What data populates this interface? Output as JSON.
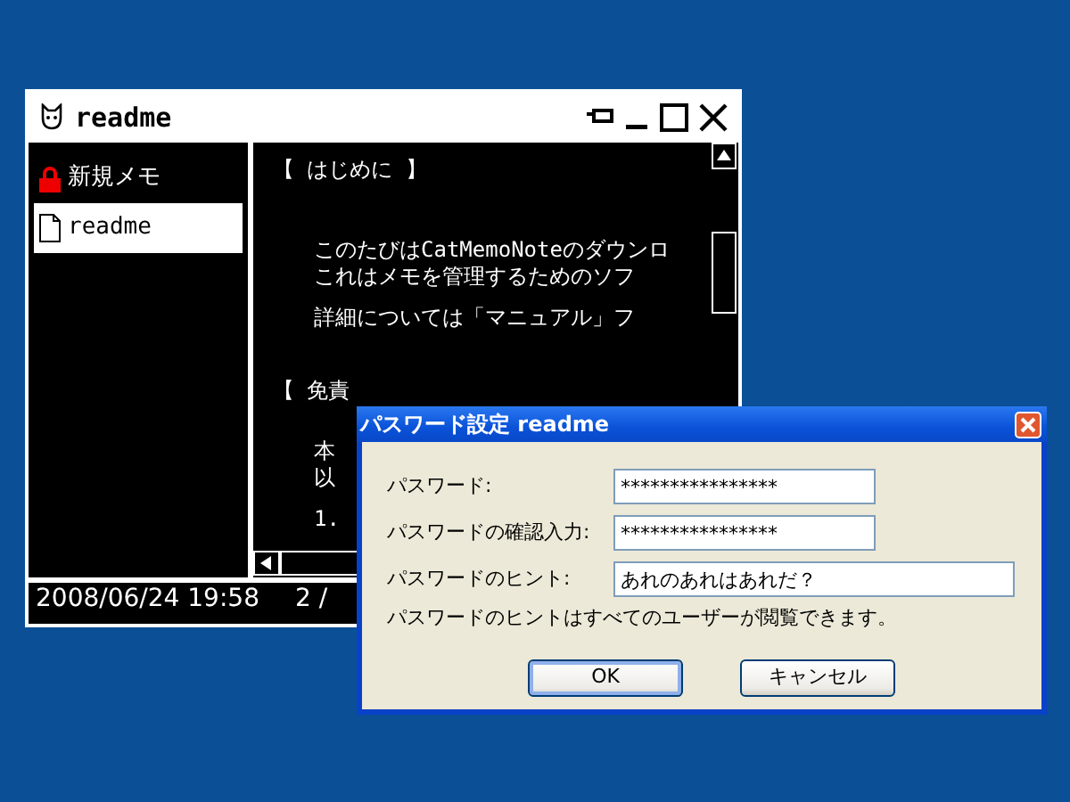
{
  "window": {
    "title": "readme"
  },
  "sidebar": {
    "items": [
      {
        "label": "新規メモ",
        "kind": "locked",
        "selected": false
      },
      {
        "label": "readme",
        "kind": "document",
        "selected": true
      }
    ]
  },
  "editor": {
    "blocks": [
      {
        "kind": "heading",
        "lines": [
          "【 はじめに 】"
        ]
      },
      {
        "kind": "body",
        "lines": [
          "このたびはCatMemoNoteのダウンロ",
          "これはメモを管理するためのソフ"
        ]
      },
      {
        "kind": "body",
        "lines": [
          "詳細については「マニュアル」フ"
        ]
      },
      {
        "kind": "heading",
        "lines": [
          "【 免責"
        ]
      },
      {
        "kind": "body",
        "lines": [
          "本",
          "以"
        ]
      },
      {
        "kind": "body",
        "lines": [
          "1."
        ]
      }
    ]
  },
  "status_bar": {
    "datetime": "2008/06/24 19:58",
    "page": "2 /"
  },
  "dialog": {
    "title": "パスワード設定 readme",
    "fields": [
      {
        "label": "パスワード:",
        "value": "****************",
        "kind": "short"
      },
      {
        "label": "パスワードの確認入力:",
        "value": "****************",
        "kind": "short"
      },
      {
        "label": "パスワードのヒント:",
        "value": "あれのあれはあれだ？",
        "kind": "long"
      }
    ],
    "note": "パスワードのヒントはすべてのユーザーが閲覧できます。",
    "buttons": [
      {
        "label": "OK",
        "default": true
      },
      {
        "label": "キャンセル",
        "default": false
      }
    ]
  }
}
